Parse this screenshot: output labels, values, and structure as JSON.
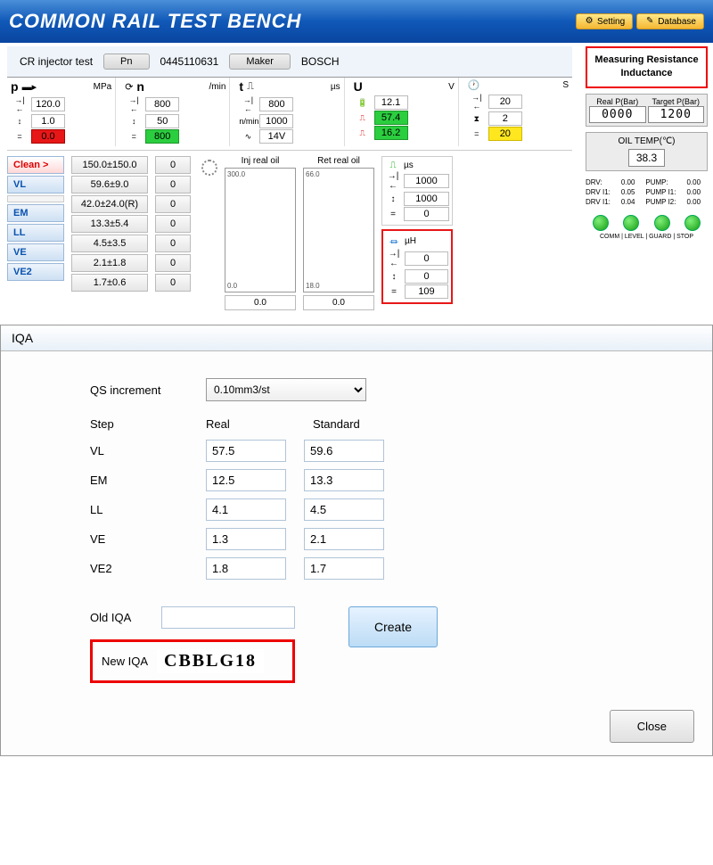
{
  "header": {
    "title": "COMMON RAIL TEST BENCH",
    "setting": "Setting",
    "database": "Database"
  },
  "info": {
    "test_label": "CR injector test",
    "pn_btn": "Pn",
    "pn": "0445110631",
    "maker_btn": "Maker",
    "maker": "BOSCH"
  },
  "gauges": {
    "p": {
      "sym": "p",
      "unit": "MPa",
      "v1": "120.0",
      "v2": "1.0",
      "v3": "0.0"
    },
    "n": {
      "sym": "n",
      "unit": "/min",
      "v1": "800",
      "v2": "50",
      "v3": "800"
    },
    "t": {
      "sym": "t",
      "unit": "µs",
      "v1": "800",
      "v2": "1000",
      "v3": "14V",
      "sub": "n/min"
    },
    "u": {
      "sym": "U",
      "unit": "V",
      "v1": "12.1",
      "v2": "57.4",
      "v3": "16.2"
    },
    "s": {
      "sym": "",
      "unit": "S",
      "v1": "20",
      "v2": "2",
      "v3": "20"
    }
  },
  "steps": {
    "rows": [
      {
        "name": "Clean >",
        "val": "150.0±150.0",
        "z": "0",
        "cls": "act"
      },
      {
        "name": "VL",
        "val": "59.6±9.0",
        "z": "0",
        "cls": ""
      },
      {
        "name": "",
        "val": "42.0±24.0(R)",
        "z": "0",
        "cls": "blank"
      },
      {
        "name": "EM",
        "val": "13.3±5.4",
        "z": "0",
        "cls": ""
      },
      {
        "name": "LL",
        "val": "4.5±3.5",
        "z": "0",
        "cls": ""
      },
      {
        "name": "VE",
        "val": "2.1±1.8",
        "z": "0",
        "cls": ""
      },
      {
        "name": "VE2",
        "val": "1.7±0.6",
        "z": "0",
        "cls": ""
      }
    ]
  },
  "oil": {
    "inj_label": "Inj real oil",
    "ret_label": "Ret real oil",
    "inj_top": "300.0",
    "inj_bot": "0.0",
    "ret_top": "66.0",
    "ret_bot": "18.0",
    "inj_val": "0.0",
    "ret_val": "0.0"
  },
  "micro": {
    "us_unit": "µs",
    "us_v1": "1000",
    "us_v2": "1000",
    "us_v3": "0",
    "uh_unit": "µH",
    "uh_v1": "0",
    "uh_v2": "0",
    "uh_v3": "109"
  },
  "right": {
    "callout": "Measuring Resistance Inductance",
    "realp": "Real P(Bar)",
    "targetp": "Target P(Bar)",
    "realp_v": "0000",
    "targetp_v": "1200",
    "oiltemp_label": "OIL TEMP(℃)",
    "oiltemp_v": "38.3",
    "stats": {
      "r1a": "DRV:",
      "r1b": "0.00",
      "r1c": "PUMP:",
      "r1d": "0.00",
      "r2a": "DRV I1:",
      "r2b": "0.05",
      "r2c": "PUMP I1:",
      "r2d": "0.00",
      "r3a": "DRV I1:",
      "r3b": "0.04",
      "r3c": "PUMP I2:",
      "r3d": "0.00"
    },
    "led_labels": "COMM | LEVEL | GUARD | STOP"
  },
  "iqa": {
    "title": "IQA",
    "qs_label": "QS increment",
    "qs_val": "0.10mm3/st",
    "h_step": "Step",
    "h_real": "Real",
    "h_std": "Standard",
    "rows": [
      {
        "n": "VL",
        "r": "57.5",
        "s": "59.6"
      },
      {
        "n": "EM",
        "r": "12.5",
        "s": "13.3"
      },
      {
        "n": "LL",
        "r": "4.1",
        "s": "4.5"
      },
      {
        "n": "VE",
        "r": "1.3",
        "s": "2.1"
      },
      {
        "n": "VE2",
        "r": "1.8",
        "s": "1.7"
      }
    ],
    "old_label": "Old IQA",
    "new_label": "New IQA",
    "new_code": "CBBLG18",
    "create": "Create",
    "close": "Close"
  }
}
